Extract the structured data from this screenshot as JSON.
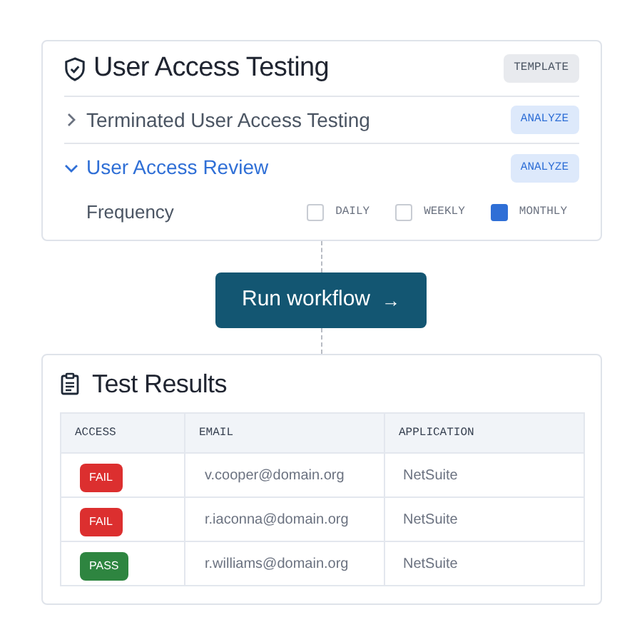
{
  "workflow_card": {
    "title": "User Access Testing",
    "badge": "TEMPLATE",
    "items": [
      {
        "label": "Terminated User Access Testing",
        "expanded": false,
        "action": "ANALYZE"
      },
      {
        "label": "User Access Review",
        "expanded": true,
        "action": "ANALYZE"
      }
    ],
    "frequency": {
      "label": "Frequency",
      "options": [
        {
          "label": "DAILY",
          "checked": false
        },
        {
          "label": "WEEKLY",
          "checked": false
        },
        {
          "label": "MONTHLY",
          "checked": true
        }
      ]
    }
  },
  "run_button": {
    "label": "Run workflow",
    "icon": "→"
  },
  "results_card": {
    "title": "Test Results",
    "table": {
      "columns": [
        "ACCESS",
        "EMAIL",
        "APPLICATION"
      ],
      "rows": [
        {
          "access": "FAIL",
          "color": "#dc2f2f",
          "email": "v.cooper@domain.org",
          "application": "NetSuite"
        },
        {
          "access": "FAIL",
          "color": "#dc2f2f",
          "email": "r.iaconna@domain.org",
          "application": "NetSuite"
        },
        {
          "access": "PASS",
          "color": "#2e8540",
          "email": "r.williams@domain.org",
          "application": "NetSuite"
        }
      ]
    }
  }
}
